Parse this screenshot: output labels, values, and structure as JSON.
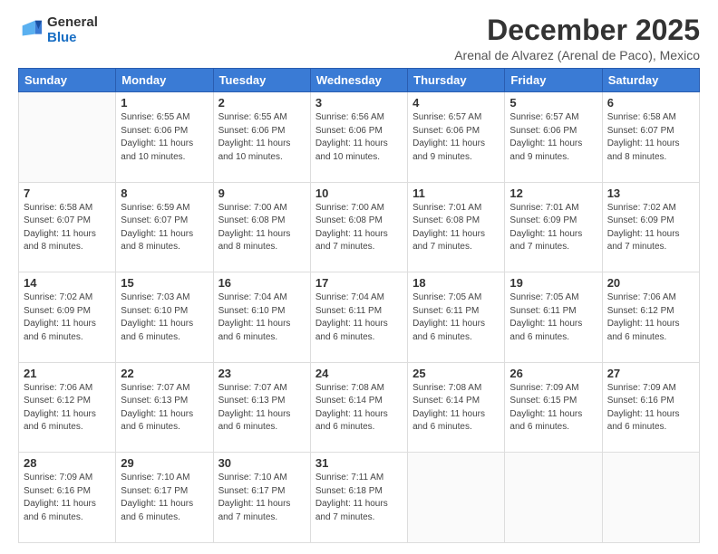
{
  "header": {
    "logo_line1": "General",
    "logo_line2": "Blue",
    "month": "December 2025",
    "location": "Arenal de Alvarez (Arenal de Paco), Mexico"
  },
  "weekdays": [
    "Sunday",
    "Monday",
    "Tuesday",
    "Wednesday",
    "Thursday",
    "Friday",
    "Saturday"
  ],
  "weeks": [
    [
      {
        "day": "",
        "info": ""
      },
      {
        "day": "1",
        "info": "Sunrise: 6:55 AM\nSunset: 6:06 PM\nDaylight: 11 hours\nand 10 minutes."
      },
      {
        "day": "2",
        "info": "Sunrise: 6:55 AM\nSunset: 6:06 PM\nDaylight: 11 hours\nand 10 minutes."
      },
      {
        "day": "3",
        "info": "Sunrise: 6:56 AM\nSunset: 6:06 PM\nDaylight: 11 hours\nand 10 minutes."
      },
      {
        "day": "4",
        "info": "Sunrise: 6:57 AM\nSunset: 6:06 PM\nDaylight: 11 hours\nand 9 minutes."
      },
      {
        "day": "5",
        "info": "Sunrise: 6:57 AM\nSunset: 6:06 PM\nDaylight: 11 hours\nand 9 minutes."
      },
      {
        "day": "6",
        "info": "Sunrise: 6:58 AM\nSunset: 6:07 PM\nDaylight: 11 hours\nand 8 minutes."
      }
    ],
    [
      {
        "day": "7",
        "info": "Sunrise: 6:58 AM\nSunset: 6:07 PM\nDaylight: 11 hours\nand 8 minutes."
      },
      {
        "day": "8",
        "info": "Sunrise: 6:59 AM\nSunset: 6:07 PM\nDaylight: 11 hours\nand 8 minutes."
      },
      {
        "day": "9",
        "info": "Sunrise: 7:00 AM\nSunset: 6:08 PM\nDaylight: 11 hours\nand 8 minutes."
      },
      {
        "day": "10",
        "info": "Sunrise: 7:00 AM\nSunset: 6:08 PM\nDaylight: 11 hours\nand 7 minutes."
      },
      {
        "day": "11",
        "info": "Sunrise: 7:01 AM\nSunset: 6:08 PM\nDaylight: 11 hours\nand 7 minutes."
      },
      {
        "day": "12",
        "info": "Sunrise: 7:01 AM\nSunset: 6:09 PM\nDaylight: 11 hours\nand 7 minutes."
      },
      {
        "day": "13",
        "info": "Sunrise: 7:02 AM\nSunset: 6:09 PM\nDaylight: 11 hours\nand 7 minutes."
      }
    ],
    [
      {
        "day": "14",
        "info": "Sunrise: 7:02 AM\nSunset: 6:09 PM\nDaylight: 11 hours\nand 6 minutes."
      },
      {
        "day": "15",
        "info": "Sunrise: 7:03 AM\nSunset: 6:10 PM\nDaylight: 11 hours\nand 6 minutes."
      },
      {
        "day": "16",
        "info": "Sunrise: 7:04 AM\nSunset: 6:10 PM\nDaylight: 11 hours\nand 6 minutes."
      },
      {
        "day": "17",
        "info": "Sunrise: 7:04 AM\nSunset: 6:11 PM\nDaylight: 11 hours\nand 6 minutes."
      },
      {
        "day": "18",
        "info": "Sunrise: 7:05 AM\nSunset: 6:11 PM\nDaylight: 11 hours\nand 6 minutes."
      },
      {
        "day": "19",
        "info": "Sunrise: 7:05 AM\nSunset: 6:11 PM\nDaylight: 11 hours\nand 6 minutes."
      },
      {
        "day": "20",
        "info": "Sunrise: 7:06 AM\nSunset: 6:12 PM\nDaylight: 11 hours\nand 6 minutes."
      }
    ],
    [
      {
        "day": "21",
        "info": "Sunrise: 7:06 AM\nSunset: 6:12 PM\nDaylight: 11 hours\nand 6 minutes."
      },
      {
        "day": "22",
        "info": "Sunrise: 7:07 AM\nSunset: 6:13 PM\nDaylight: 11 hours\nand 6 minutes."
      },
      {
        "day": "23",
        "info": "Sunrise: 7:07 AM\nSunset: 6:13 PM\nDaylight: 11 hours\nand 6 minutes."
      },
      {
        "day": "24",
        "info": "Sunrise: 7:08 AM\nSunset: 6:14 PM\nDaylight: 11 hours\nand 6 minutes."
      },
      {
        "day": "25",
        "info": "Sunrise: 7:08 AM\nSunset: 6:14 PM\nDaylight: 11 hours\nand 6 minutes."
      },
      {
        "day": "26",
        "info": "Sunrise: 7:09 AM\nSunset: 6:15 PM\nDaylight: 11 hours\nand 6 minutes."
      },
      {
        "day": "27",
        "info": "Sunrise: 7:09 AM\nSunset: 6:16 PM\nDaylight: 11 hours\nand 6 minutes."
      }
    ],
    [
      {
        "day": "28",
        "info": "Sunrise: 7:09 AM\nSunset: 6:16 PM\nDaylight: 11 hours\nand 6 minutes."
      },
      {
        "day": "29",
        "info": "Sunrise: 7:10 AM\nSunset: 6:17 PM\nDaylight: 11 hours\nand 6 minutes."
      },
      {
        "day": "30",
        "info": "Sunrise: 7:10 AM\nSunset: 6:17 PM\nDaylight: 11 hours\nand 7 minutes."
      },
      {
        "day": "31",
        "info": "Sunrise: 7:11 AM\nSunset: 6:18 PM\nDaylight: 11 hours\nand 7 minutes."
      },
      {
        "day": "",
        "info": ""
      },
      {
        "day": "",
        "info": ""
      },
      {
        "day": "",
        "info": ""
      }
    ]
  ]
}
